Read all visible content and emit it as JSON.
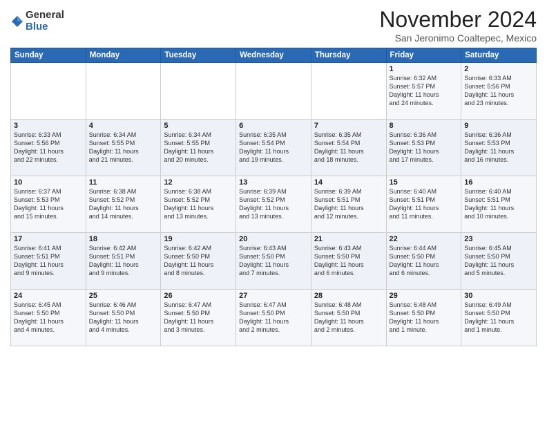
{
  "header": {
    "logo_general": "General",
    "logo_blue": "Blue",
    "month_title": "November 2024",
    "location": "San Jeronimo Coaltepec, Mexico"
  },
  "days_of_week": [
    "Sunday",
    "Monday",
    "Tuesday",
    "Wednesday",
    "Thursday",
    "Friday",
    "Saturday"
  ],
  "weeks": [
    [
      {
        "day": "",
        "info": ""
      },
      {
        "day": "",
        "info": ""
      },
      {
        "day": "",
        "info": ""
      },
      {
        "day": "",
        "info": ""
      },
      {
        "day": "",
        "info": ""
      },
      {
        "day": "1",
        "info": "Sunrise: 6:32 AM\nSunset: 5:57 PM\nDaylight: 11 hours\nand 24 minutes."
      },
      {
        "day": "2",
        "info": "Sunrise: 6:33 AM\nSunset: 5:56 PM\nDaylight: 11 hours\nand 23 minutes."
      }
    ],
    [
      {
        "day": "3",
        "info": "Sunrise: 6:33 AM\nSunset: 5:56 PM\nDaylight: 11 hours\nand 22 minutes."
      },
      {
        "day": "4",
        "info": "Sunrise: 6:34 AM\nSunset: 5:55 PM\nDaylight: 11 hours\nand 21 minutes."
      },
      {
        "day": "5",
        "info": "Sunrise: 6:34 AM\nSunset: 5:55 PM\nDaylight: 11 hours\nand 20 minutes."
      },
      {
        "day": "6",
        "info": "Sunrise: 6:35 AM\nSunset: 5:54 PM\nDaylight: 11 hours\nand 19 minutes."
      },
      {
        "day": "7",
        "info": "Sunrise: 6:35 AM\nSunset: 5:54 PM\nDaylight: 11 hours\nand 18 minutes."
      },
      {
        "day": "8",
        "info": "Sunrise: 6:36 AM\nSunset: 5:53 PM\nDaylight: 11 hours\nand 17 minutes."
      },
      {
        "day": "9",
        "info": "Sunrise: 6:36 AM\nSunset: 5:53 PM\nDaylight: 11 hours\nand 16 minutes."
      }
    ],
    [
      {
        "day": "10",
        "info": "Sunrise: 6:37 AM\nSunset: 5:53 PM\nDaylight: 11 hours\nand 15 minutes."
      },
      {
        "day": "11",
        "info": "Sunrise: 6:38 AM\nSunset: 5:52 PM\nDaylight: 11 hours\nand 14 minutes."
      },
      {
        "day": "12",
        "info": "Sunrise: 6:38 AM\nSunset: 5:52 PM\nDaylight: 11 hours\nand 13 minutes."
      },
      {
        "day": "13",
        "info": "Sunrise: 6:39 AM\nSunset: 5:52 PM\nDaylight: 11 hours\nand 13 minutes."
      },
      {
        "day": "14",
        "info": "Sunrise: 6:39 AM\nSunset: 5:51 PM\nDaylight: 11 hours\nand 12 minutes."
      },
      {
        "day": "15",
        "info": "Sunrise: 6:40 AM\nSunset: 5:51 PM\nDaylight: 11 hours\nand 11 minutes."
      },
      {
        "day": "16",
        "info": "Sunrise: 6:40 AM\nSunset: 5:51 PM\nDaylight: 11 hours\nand 10 minutes."
      }
    ],
    [
      {
        "day": "17",
        "info": "Sunrise: 6:41 AM\nSunset: 5:51 PM\nDaylight: 11 hours\nand 9 minutes."
      },
      {
        "day": "18",
        "info": "Sunrise: 6:42 AM\nSunset: 5:51 PM\nDaylight: 11 hours\nand 9 minutes."
      },
      {
        "day": "19",
        "info": "Sunrise: 6:42 AM\nSunset: 5:50 PM\nDaylight: 11 hours\nand 8 minutes."
      },
      {
        "day": "20",
        "info": "Sunrise: 6:43 AM\nSunset: 5:50 PM\nDaylight: 11 hours\nand 7 minutes."
      },
      {
        "day": "21",
        "info": "Sunrise: 6:43 AM\nSunset: 5:50 PM\nDaylight: 11 hours\nand 6 minutes."
      },
      {
        "day": "22",
        "info": "Sunrise: 6:44 AM\nSunset: 5:50 PM\nDaylight: 11 hours\nand 6 minutes."
      },
      {
        "day": "23",
        "info": "Sunrise: 6:45 AM\nSunset: 5:50 PM\nDaylight: 11 hours\nand 5 minutes."
      }
    ],
    [
      {
        "day": "24",
        "info": "Sunrise: 6:45 AM\nSunset: 5:50 PM\nDaylight: 11 hours\nand 4 minutes."
      },
      {
        "day": "25",
        "info": "Sunrise: 6:46 AM\nSunset: 5:50 PM\nDaylight: 11 hours\nand 4 minutes."
      },
      {
        "day": "26",
        "info": "Sunrise: 6:47 AM\nSunset: 5:50 PM\nDaylight: 11 hours\nand 3 minutes."
      },
      {
        "day": "27",
        "info": "Sunrise: 6:47 AM\nSunset: 5:50 PM\nDaylight: 11 hours\nand 2 minutes."
      },
      {
        "day": "28",
        "info": "Sunrise: 6:48 AM\nSunset: 5:50 PM\nDaylight: 11 hours\nand 2 minutes."
      },
      {
        "day": "29",
        "info": "Sunrise: 6:48 AM\nSunset: 5:50 PM\nDaylight: 11 hours\nand 1 minute."
      },
      {
        "day": "30",
        "info": "Sunrise: 6:49 AM\nSunset: 5:50 PM\nDaylight: 11 hours\nand 1 minute."
      }
    ]
  ]
}
